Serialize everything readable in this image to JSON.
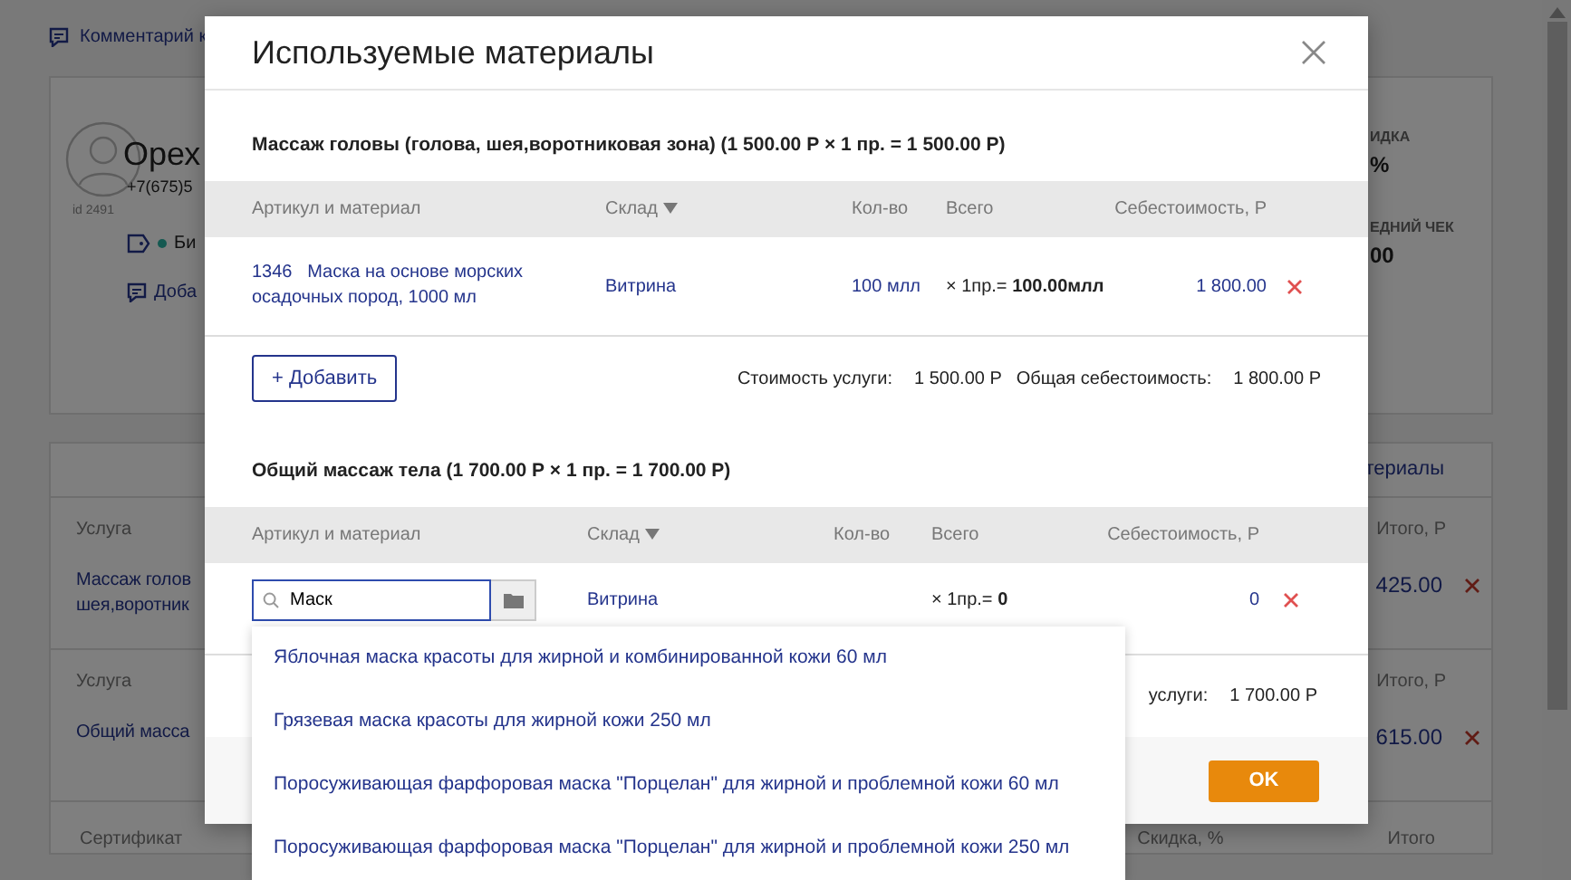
{
  "background": {
    "comment_link": "Комментарий к",
    "client": {
      "name": "Орех",
      "phone": "+7(675)5",
      "id": "id 2491",
      "status": "Би",
      "add_link": "Доба"
    },
    "stats": [
      {
        "label": "ИДКА",
        "value": "%"
      },
      {
        "label": "ЕДНИЙ ЧЕК",
        "value": "00"
      }
    ],
    "tab_link": "териалы",
    "services": [
      {
        "column": "Услуга",
        "name_lines": [
          "Массаж голов",
          "шея,воротник"
        ],
        "total_column": "Итого, Р",
        "total": "425.00"
      },
      {
        "column": "Услуга",
        "name_lines": [
          "Общий масса"
        ],
        "total_column": "Итого, Р",
        "total": "615.00"
      }
    ],
    "certificate": {
      "column": "Сертификат",
      "discount_column": "Скидка, %",
      "total_column": "Итого"
    }
  },
  "modal": {
    "title": "Используемые материалы",
    "sections": [
      {
        "title": "Массаж головы (голова, шея,воротниковая зона) (1 500.00 Р × 1 пр. = 1 500.00 Р)",
        "columns": [
          "Артикул и материал",
          "Склад",
          "Кол-во",
          "Всего",
          "Себестоимость, Р"
        ],
        "rows": [
          {
            "kind": "item",
            "article": "1346",
            "material": "Маска на основе морских осадочных пород, 1000 мл",
            "warehouse": "Витрина",
            "quantity": "100 млл",
            "total": "× 1пр.= **100.00млл**",
            "cost": "1 800.00"
          }
        ],
        "add_button": "+ Добавить",
        "summary": [
          {
            "label": "Стоимость услуги:",
            "value": "1 500.00 Р"
          },
          {
            "label": "Общая себестоимость:",
            "value": "1 800.00 Р"
          }
        ]
      },
      {
        "title": "Общий массаж тела (1 700.00 Р × 1 пр. = 1 700.00 Р)",
        "columns": [
          "Артикул и материал",
          "Склад",
          "Кол-во",
          "Всего",
          "Себестоимость, Р"
        ],
        "rows": [
          {
            "kind": "search",
            "query": "Маск",
            "warehouse": "Витрина",
            "total": "× 1пр.= **0**",
            "cost": "0",
            "suggestions": [
              "Яблочная маска красоты для жирной и комбинированной кожи 60 мл",
              "Грязевая маска красоты для жирной кожи 250 мл",
              "Поросуживающая фарфоровая маска \"Порцелан\" для жирной и проблемной кожи 60 мл",
              "Поросуживающая фарфоровая маска \"Порцелан\" для жирной и проблемной кожи 250 мл"
            ]
          }
        ],
        "summary": [
          {
            "label": "услуги:",
            "value": "1 700.00 Р"
          }
        ]
      }
    ],
    "ok_button": "OK"
  }
}
